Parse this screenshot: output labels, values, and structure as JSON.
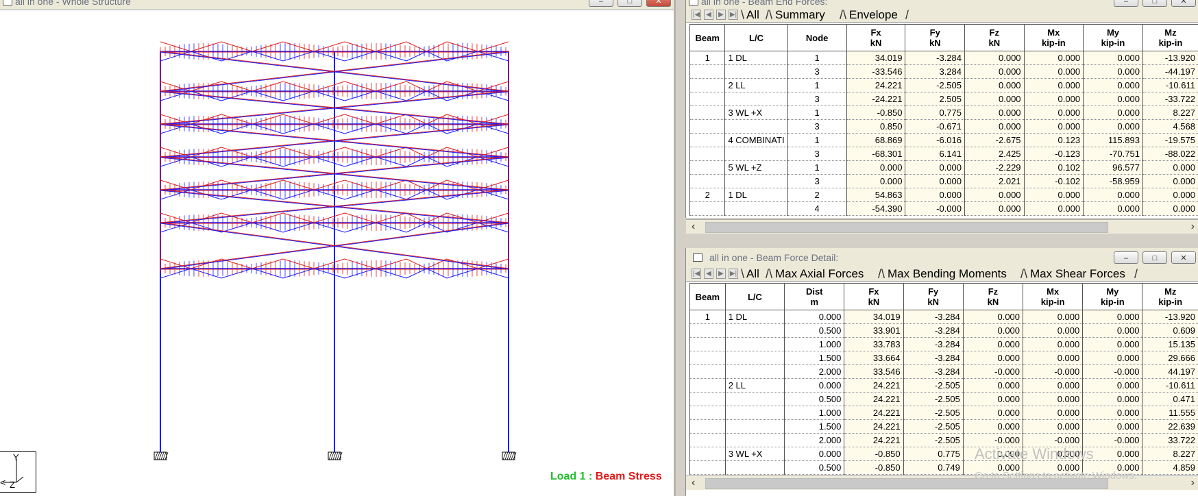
{
  "left_window": {
    "title": "all in one - Whole Structure",
    "load_label_part1": "Load 1 : ",
    "load_label_part2": "Beam Stress",
    "axis_labels": {
      "y": "Y",
      "z": "Z"
    }
  },
  "beam_end_forces": {
    "title": "all in one - Beam End Forces:",
    "tabs": [
      "All",
      "Summary",
      "Envelope"
    ],
    "columns": [
      {
        "line1": "Beam",
        "line2": ""
      },
      {
        "line1": "L/C",
        "line2": ""
      },
      {
        "line1": "Node",
        "line2": ""
      },
      {
        "line1": "Fx",
        "line2": "kN"
      },
      {
        "line1": "Fy",
        "line2": "kN"
      },
      {
        "line1": "Fz",
        "line2": "kN"
      },
      {
        "line1": "Mx",
        "line2": "kip-in"
      },
      {
        "line1": "My",
        "line2": "kip-in"
      },
      {
        "line1": "Mz",
        "line2": "kip-in"
      }
    ],
    "rows": [
      [
        "1",
        "1 DL",
        "1",
        "34.019",
        "-3.284",
        "0.000",
        "0.000",
        "0.000",
        "-13.920"
      ],
      [
        "",
        "",
        "3",
        "-33.546",
        "3.284",
        "0.000",
        "0.000",
        "0.000",
        "-44.197"
      ],
      [
        "",
        "2 LL",
        "1",
        "24.221",
        "-2.505",
        "0.000",
        "0.000",
        "0.000",
        "-10.611"
      ],
      [
        "",
        "",
        "3",
        "-24.221",
        "2.505",
        "0.000",
        "0.000",
        "0.000",
        "-33.722"
      ],
      [
        "",
        "3 WL +X",
        "1",
        "-0.850",
        "0.775",
        "0.000",
        "0.000",
        "0.000",
        "8.227"
      ],
      [
        "",
        "",
        "3",
        "0.850",
        "-0.671",
        "0.000",
        "0.000",
        "0.000",
        "4.568"
      ],
      [
        "",
        "4 COMBINATI",
        "1",
        "68.869",
        "-6.016",
        "-2.675",
        "0.123",
        "115.893",
        "-19.575"
      ],
      [
        "",
        "",
        "3",
        "-68.301",
        "6.141",
        "2.425",
        "-0.123",
        "-70.751",
        "-88.022"
      ],
      [
        "",
        "5 WL +Z",
        "1",
        "0.000",
        "0.000",
        "-2.229",
        "0.102",
        "96.577",
        "0.000"
      ],
      [
        "",
        "",
        "3",
        "0.000",
        "0.000",
        "2.021",
        "-0.102",
        "-58.959",
        "0.000"
      ],
      [
        "2",
        "1 DL",
        "2",
        "54.863",
        "0.000",
        "0.000",
        "0.000",
        "0.000",
        "0.000"
      ],
      [
        "",
        "",
        "4",
        "-54.390",
        "-0.000",
        "0.000",
        "0.000",
        "0.000",
        "0.000"
      ]
    ]
  },
  "beam_force_detail": {
    "title": "all in one - Beam Force Detail:",
    "tabs": [
      "All",
      "Max Axial Forces",
      "Max Bending Moments",
      "Max Shear Forces"
    ],
    "columns": [
      {
        "line1": "Beam",
        "line2": ""
      },
      {
        "line1": "L/C",
        "line2": ""
      },
      {
        "line1": "Dist",
        "line2": "m"
      },
      {
        "line1": "Fx",
        "line2": "kN"
      },
      {
        "line1": "Fy",
        "line2": "kN"
      },
      {
        "line1": "Fz",
        "line2": "kN"
      },
      {
        "line1": "Mx",
        "line2": "kip-in"
      },
      {
        "line1": "My",
        "line2": "kip-in"
      },
      {
        "line1": "Mz",
        "line2": "kip-in"
      }
    ],
    "rows": [
      [
        "1",
        "1 DL",
        "0.000",
        "34.019",
        "-3.284",
        "0.000",
        "0.000",
        "0.000",
        "-13.920"
      ],
      [
        "",
        "",
        "0.500",
        "33.901",
        "-3.284",
        "0.000",
        "0.000",
        "0.000",
        "0.609"
      ],
      [
        "",
        "",
        "1.000",
        "33.783",
        "-3.284",
        "0.000",
        "0.000",
        "0.000",
        "15.135"
      ],
      [
        "",
        "",
        "1.500",
        "33.664",
        "-3.284",
        "0.000",
        "0.000",
        "0.000",
        "29.666"
      ],
      [
        "",
        "",
        "2.000",
        "33.546",
        "-3.284",
        "-0.000",
        "-0.000",
        "-0.000",
        "44.197"
      ],
      [
        "",
        "2 LL",
        "0.000",
        "24.221",
        "-2.505",
        "0.000",
        "0.000",
        "0.000",
        "-10.611"
      ],
      [
        "",
        "",
        "0.500",
        "24.221",
        "-2.505",
        "0.000",
        "0.000",
        "0.000",
        "0.471"
      ],
      [
        "",
        "",
        "1.000",
        "24.221",
        "-2.505",
        "0.000",
        "0.000",
        "0.000",
        "11.555"
      ],
      [
        "",
        "",
        "1.500",
        "24.221",
        "-2.505",
        "0.000",
        "0.000",
        "0.000",
        "22.639"
      ],
      [
        "",
        "",
        "2.000",
        "24.221",
        "-2.505",
        "-0.000",
        "-0.000",
        "-0.000",
        "33.722"
      ],
      [
        "",
        "3 WL +X",
        "0.000",
        "-0.850",
        "0.775",
        "0.000",
        "0.000",
        "0.000",
        "8.227"
      ],
      [
        "",
        "",
        "0.500",
        "-0.850",
        "0.749",
        "0.000",
        "0.000",
        "0.000",
        "4.859"
      ]
    ]
  },
  "watermark": {
    "line1": "Activate Windows",
    "line2": "Go to Settings to activate Windows."
  },
  "colors": {
    "frame_blue": "#1a1aff",
    "stress_red": "#e01818",
    "label_green": "#1fbf2a"
  }
}
